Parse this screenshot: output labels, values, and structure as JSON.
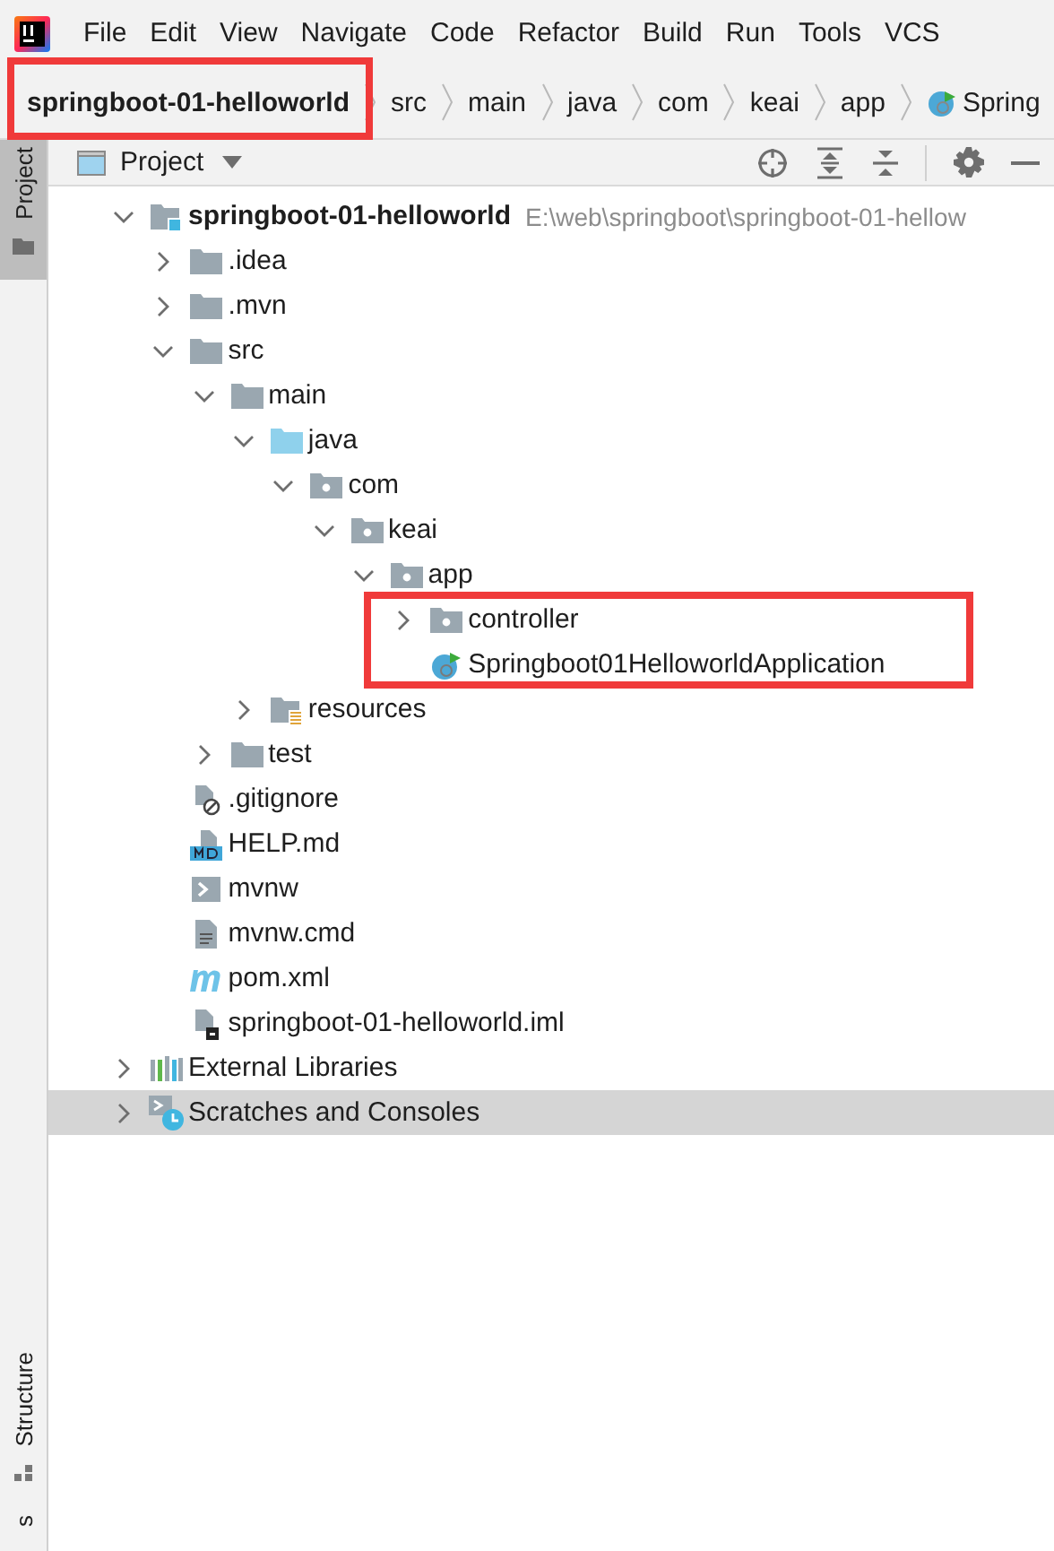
{
  "menu": [
    "File",
    "Edit",
    "View",
    "Navigate",
    "Code",
    "Refactor",
    "Build",
    "Run",
    "Tools",
    "VCS"
  ],
  "breadcrumbs": [
    {
      "label": "springboot-01-helloworld",
      "kind": "module",
      "highlighted": true
    },
    {
      "label": "src",
      "kind": "folder",
      "highlighted": false
    },
    {
      "label": "main",
      "kind": "folder",
      "highlighted": false
    },
    {
      "label": "java",
      "kind": "folder",
      "highlighted": false
    },
    {
      "label": "com",
      "kind": "folder",
      "highlighted": false
    },
    {
      "label": "keai",
      "kind": "folder",
      "highlighted": false
    },
    {
      "label": "app",
      "kind": "folder",
      "highlighted": false
    },
    {
      "label": "Spring",
      "kind": "spring-class",
      "highlighted": false
    }
  ],
  "left_stripe": {
    "top": [
      {
        "label": "Project",
        "selected": true
      }
    ],
    "bottom": [
      {
        "label": "Structure",
        "selected": false
      },
      {
        "label": "s",
        "selected": false
      }
    ]
  },
  "panel": {
    "title": "Project"
  },
  "tree": [
    {
      "label": "springboot-01-helloworld",
      "path": "E:\\web\\springboot\\springboot-01-hellow",
      "kind": "module",
      "expanded": true,
      "selected": false,
      "children": [
        {
          "label": ".idea",
          "kind": "folder",
          "expanded": false,
          "selected": false
        },
        {
          "label": ".mvn",
          "kind": "folder",
          "expanded": false,
          "selected": false
        },
        {
          "label": "src",
          "kind": "folder",
          "expanded": true,
          "selected": false,
          "children": [
            {
              "label": "main",
              "kind": "folder",
              "expanded": true,
              "selected": false,
              "children": [
                {
                  "label": "java",
                  "kind": "source-folder",
                  "expanded": true,
                  "selected": false,
                  "children": [
                    {
                      "label": "com",
                      "kind": "package",
                      "expanded": true,
                      "selected": false,
                      "children": [
                        {
                          "label": "keai",
                          "kind": "package",
                          "expanded": true,
                          "selected": false,
                          "children": [
                            {
                              "label": "app",
                              "kind": "package",
                              "expanded": true,
                              "selected": false,
                              "children": [
                                {
                                  "label": "controller",
                                  "kind": "package",
                                  "expanded": false,
                                  "selected": false,
                                  "highlighted": true
                                },
                                {
                                  "label": "Springboot01HelloworldApplication",
                                  "kind": "spring-class",
                                  "selected": false,
                                  "highlighted": true
                                }
                              ]
                            }
                          ]
                        }
                      ]
                    }
                  ]
                },
                {
                  "label": "resources",
                  "kind": "resources-folder",
                  "expanded": false,
                  "selected": false
                }
              ]
            },
            {
              "label": "test",
              "kind": "folder",
              "expanded": false,
              "selected": false
            }
          ]
        },
        {
          "label": ".gitignore",
          "kind": "gitignore",
          "selected": false
        },
        {
          "label": "HELP.md",
          "kind": "markdown",
          "selected": false
        },
        {
          "label": "mvnw",
          "kind": "shell",
          "selected": false
        },
        {
          "label": "mvnw.cmd",
          "kind": "text-file",
          "selected": false
        },
        {
          "label": "pom.xml",
          "kind": "maven",
          "selected": false
        },
        {
          "label": "springboot-01-helloworld.iml",
          "kind": "iml",
          "selected": false
        }
      ]
    },
    {
      "label": "External Libraries",
      "kind": "libraries",
      "expanded": false,
      "selected": false
    },
    {
      "label": "Scratches and Consoles",
      "kind": "scratches",
      "expanded": false,
      "selected": true
    }
  ]
}
